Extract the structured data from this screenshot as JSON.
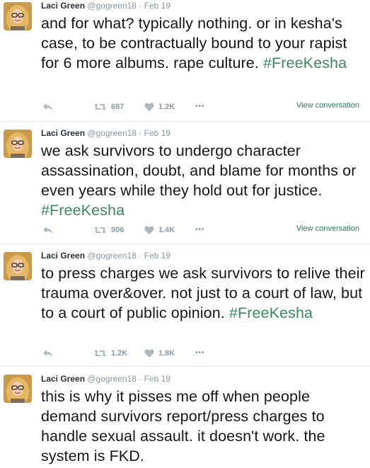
{
  "tweets": [
    {
      "name": "Laci Green",
      "handle": "@gogreen18",
      "separator": "·",
      "date": "Feb 19",
      "text_main": "and for what?  typically nothing.  or in kesha's case, to be contractually bound to your rapist for 6 more albums.  rape culture. ",
      "hashtag": "#FreeKesha",
      "retweets": "687",
      "likes": "1.2K",
      "more": "•••",
      "view_conversation": "View conversation"
    },
    {
      "name": "Laci Green",
      "handle": "@gogreen18",
      "separator": "·",
      "date": "Feb 19",
      "text_main": "we ask survivors to undergo character assassination, doubt, and blame for months or even years while they hold out for justice. ",
      "hashtag": "#FreeKesha",
      "retweets": "906",
      "likes": "1.4K",
      "more": "•••",
      "view_conversation": "View conversation"
    },
    {
      "name": "Laci Green",
      "handle": "@gogreen18",
      "separator": "·",
      "date": "Feb 19",
      "text_main": "to press charges we ask survivors to relive their trauma over&over. not just to a court of law, but to a court of public opinion. ",
      "hashtag": "#FreeKesha",
      "retweets": "1.2K",
      "likes": "1.8K",
      "more": "•••"
    },
    {
      "name": "Laci Green",
      "handle": "@gogreen18",
      "separator": "·",
      "date": "Feb 19",
      "text_main": "this is why it pisses me off when people demand survivors report/press charges to handle sexual assault. it doesn't work. the system is FKD."
    }
  ],
  "colors": {
    "hashtag": "#3b8a5d",
    "muted": "#8899a6",
    "text": "#14171a",
    "divider": "#e1e8ed"
  }
}
